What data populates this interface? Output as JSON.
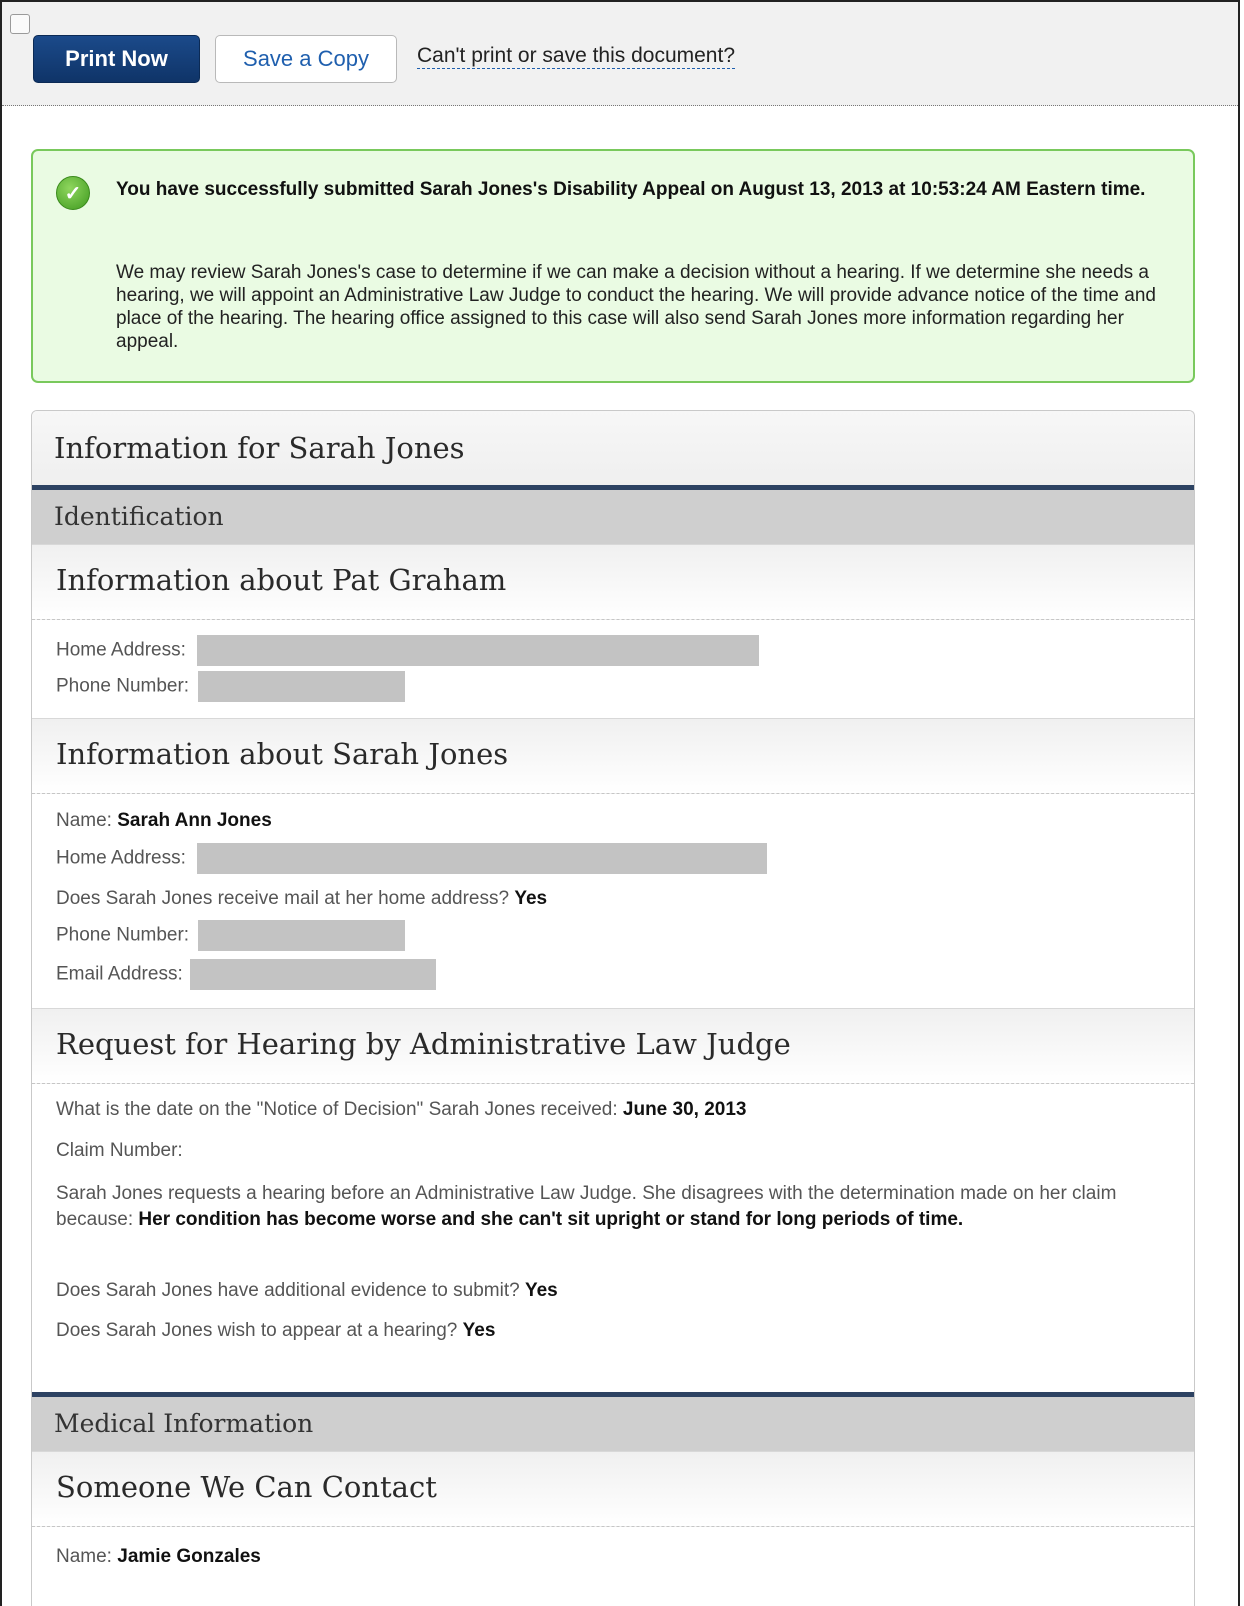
{
  "toolbar": {
    "print_label": "Print Now",
    "save_label": "Save a Copy",
    "help_link": "Can't print or save this document?"
  },
  "success": {
    "title": "You have successfully submitted Sarah Jones's Disability Appeal on August 13, 2013 at 10:53:24 AM Eastern time.",
    "body": "We may review Sarah Jones's case to determine if we can make a decision without a hearing. If we determine she needs a hearing, we will appoint an Administrative Law Judge to conduct the hearing. We will provide advance notice of the time and place of the hearing. The hearing office assigned to this case will also send Sarah Jones more information regarding her appeal.",
    "icon": "check-circle-icon"
  },
  "panel": {
    "title": "Information for Sarah Jones",
    "identification": {
      "label": "Identification",
      "pat": {
        "heading": "Information about Pat Graham",
        "home_address_label": "Home Address:",
        "phone_label": "Phone Number:"
      },
      "sarah": {
        "heading": "Information about Sarah Jones",
        "name_label": "Name:",
        "name_value": "Sarah Ann Jones",
        "home_address_label": "Home Address:",
        "mail_question": "Does Sarah Jones receive mail at her home address?",
        "mail_answer": "Yes",
        "phone_label": "Phone Number:",
        "email_label": "Email Address:"
      },
      "hearing": {
        "heading": "Request for Hearing by Administrative Law Judge",
        "notice_question": "What is the date on the \"Notice of Decision\" Sarah Jones received:",
        "notice_answer": "June 30, 2013",
        "claim_label": "Claim Number:",
        "request_text": "Sarah Jones requests a hearing before an Administrative Law Judge. She disagrees with the determination made on her claim because:",
        "request_reason": "Her condition has become worse and she can't sit upright or stand for long periods of time.",
        "evidence_question": "Does Sarah Jones have additional evidence to submit?",
        "evidence_answer": "Yes",
        "appear_question": "Does Sarah Jones wish to appear at a hearing?",
        "appear_answer": "Yes"
      }
    },
    "medical": {
      "label": "Medical Information",
      "contact": {
        "heading": "Someone We Can Contact",
        "name_label": "Name:",
        "name_value": "Jamie Gonzales"
      }
    }
  }
}
